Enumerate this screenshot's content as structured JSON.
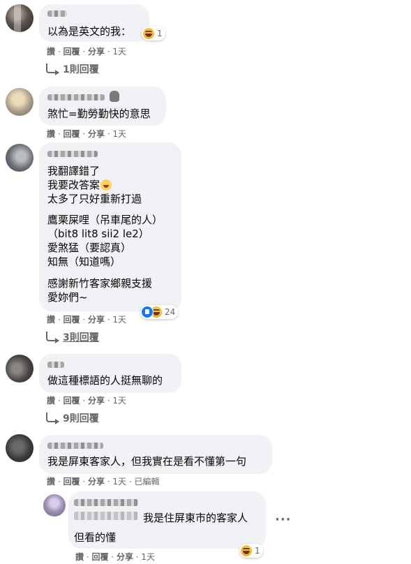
{
  "actions": {
    "like": "讚",
    "reply": "回覆",
    "share": "分享",
    "sep": " · "
  },
  "comments": [
    {
      "lines": [
        "以為是英文的我："
      ],
      "reaction_count": "1",
      "time": "1天",
      "replies_label": "1則回覆"
    },
    {
      "lines": [
        "煞忙=勤勞勤快的意思"
      ],
      "time": "1天"
    },
    {
      "lines": [
        "我翻譯錯了",
        "我要改答案",
        "太多了只好重新打過",
        "",
        "鷹栗屎哩（吊車尾的人）",
        "（bit8 lit8 sii2 le2）",
        "愛煞猛（要認真）",
        "知無（知道嗎）",
        "",
        "感謝新竹客家鄉親支援",
        "愛妳們~"
      ],
      "reaction_count": "24",
      "time": "1天",
      "replies_label": "3則回覆"
    },
    {
      "lines": [
        "做這種標語的人挺無聊的"
      ],
      "time": "1天",
      "replies_label": "9則回覆"
    },
    {
      "lines": [
        "我是屏東客家人，但我實在是看不懂第一句"
      ],
      "time": "1天",
      "edited": "已編輯"
    }
  ],
  "reply": {
    "lines": [
      "我是住屏東市的客家人",
      "但看的懂"
    ],
    "reaction_count": "1",
    "time": "1天",
    "more": "···"
  },
  "colors": {
    "bubble": "#f0f2f5",
    "meta": "#65676b",
    "like": "#1877f2",
    "haha": "#f7c23b"
  }
}
